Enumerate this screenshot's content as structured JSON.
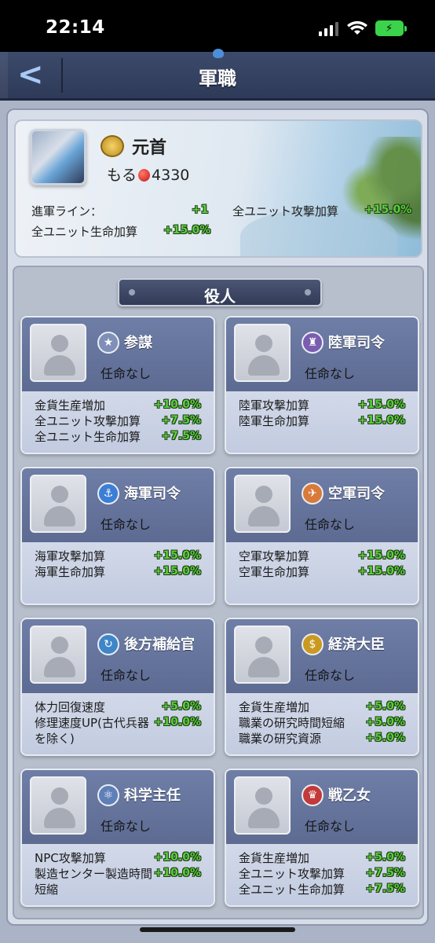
{
  "status_bar": {
    "time": "22:14"
  },
  "header": {
    "title": "軍職",
    "back": "<"
  },
  "leader": {
    "rank": "元首",
    "name": "もる",
    "power": "4330",
    "stats": [
      {
        "label": "進軍ライン：",
        "value": "+1"
      },
      {
        "label": "全ユニット攻撃加算",
        "value": "+15.0%"
      },
      {
        "label": "全ユニット生命加算",
        "value": "+15.0%"
      }
    ]
  },
  "officials": {
    "title": "役人",
    "cards": [
      {
        "title": "参謀",
        "status": "任命なし",
        "icon": "star-badge-icon",
        "color": "#7f8fb8",
        "lines": [
          {
            "label": "金貨生産増加",
            "value": "+10.0%"
          },
          {
            "label": "全ユニット攻撃加算",
            "value": "+7.5%"
          },
          {
            "label": "全ユニット生命加算",
            "value": "+7.5%"
          }
        ]
      },
      {
        "title": "陸軍司令",
        "status": "任命なし",
        "icon": "army-badge-icon",
        "color": "#7a5db0",
        "lines": [
          {
            "label": "陸軍攻撃加算",
            "value": "+15.0%"
          },
          {
            "label": "陸軍生命加算",
            "value": "+15.0%"
          }
        ]
      },
      {
        "title": "海軍司令",
        "status": "任命なし",
        "icon": "navy-badge-icon",
        "color": "#3b7ed6",
        "lines": [
          {
            "label": "海軍攻撃加算",
            "value": "+15.0%"
          },
          {
            "label": "海軍生命加算",
            "value": "+15.0%"
          }
        ]
      },
      {
        "title": "空軍司令",
        "status": "任命なし",
        "icon": "airforce-badge-icon",
        "color": "#d87a3a",
        "lines": [
          {
            "label": "空軍攻撃加算",
            "value": "+15.0%"
          },
          {
            "label": "空軍生命加算",
            "value": "+15.0%"
          }
        ]
      },
      {
        "title": "後方補給官",
        "status": "任命なし",
        "icon": "supply-badge-icon",
        "color": "#3f86c9",
        "lines": [
          {
            "label": "体力回復速度",
            "value": "+5.0%"
          },
          {
            "label": "修理速度UP(古代兵器を除く)",
            "value": "+10.0%"
          }
        ]
      },
      {
        "title": "経済大臣",
        "status": "任命なし",
        "icon": "coin-badge-icon",
        "color": "#c99a1f",
        "lines": [
          {
            "label": "金貨生産増加",
            "value": "+5.0%"
          },
          {
            "label": "職業の研究時間短縮",
            "value": "+5.0%"
          },
          {
            "label": "職業の研究資源",
            "value": "+5.0%"
          }
        ]
      },
      {
        "title": "科学主任",
        "status": "任命なし",
        "icon": "science-badge-icon",
        "color": "#5f7fb8",
        "lines": [
          {
            "label": "NPC攻撃加算",
            "value": "+10.0%"
          },
          {
            "label": "製造センター製造時間短縮",
            "value": "+10.0%"
          }
        ]
      },
      {
        "title": "戦乙女",
        "status": "任命なし",
        "icon": "valkyrie-badge-icon",
        "color": "#c23a3a",
        "lines": [
          {
            "label": "金貨生産増加",
            "value": "+5.0%"
          },
          {
            "label": "全ユニット攻撃加算",
            "value": "+7.5%"
          },
          {
            "label": "全ユニット生命加算",
            "value": "+7.5%"
          }
        ]
      }
    ]
  }
}
